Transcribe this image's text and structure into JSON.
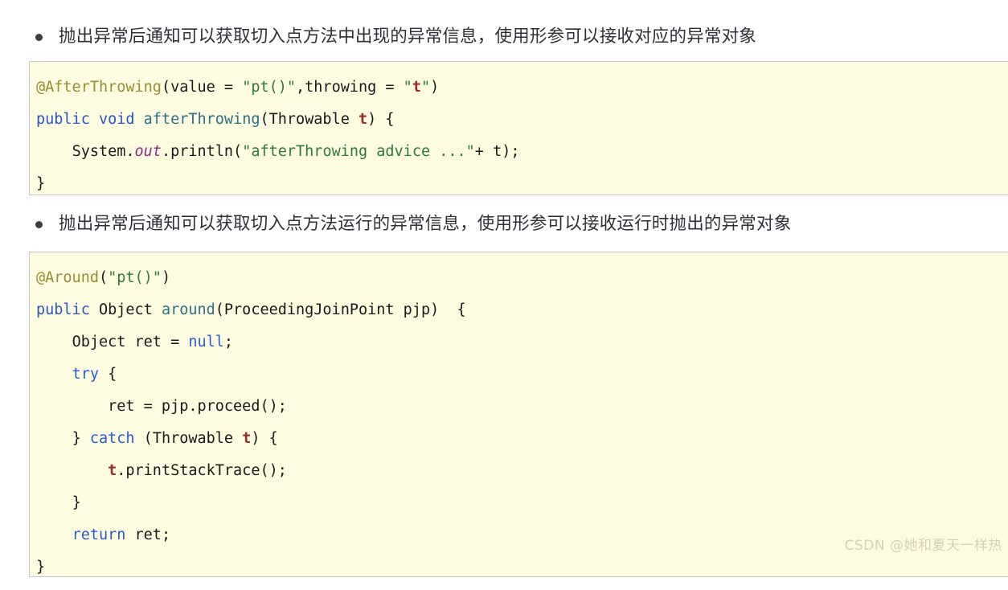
{
  "document": {
    "watermark": "CSDN @她和夏天一样热"
  },
  "sections": [
    {
      "bullet": "抛出异常后通知可以获取切入点方法中出现的异常信息，使用形参可以接收对应的异常对象",
      "code_lines": [
        "@AfterThrowing(value = \"pt()\",throwing = \"t\")",
        "public void afterThrowing(Throwable t) {",
        "    System.out.println(\"afterThrowing advice ...\"+ t);",
        "}"
      ]
    },
    {
      "bullet": "抛出异常后通知可以获取切入点方法运行的异常信息，使用形参可以接收运行时抛出的异常对象",
      "code_lines": [
        "@Around(\"pt()\")",
        "public Object around(ProceedingJoinPoint pjp)  {",
        "    Object ret = null;",
        "    try {",
        "        ret = pjp.proceed();",
        "    } catch (Throwable t) {",
        "        t.printStackTrace();",
        "    }",
        "    return ret;",
        "}"
      ]
    }
  ],
  "code_block_1": {
    "line_1": {
      "anno": "@AfterThrowing",
      "p1": "(value = ",
      "str1": "\"pt()\"",
      "p2": ",throwing = ",
      "q_open": "\"",
      "var": "t",
      "q_close": "\"",
      "p3": ")"
    },
    "line_2": {
      "kw_public": "public",
      "sp1": " ",
      "kw_void": "void",
      "sp2": " ",
      "meth": "afterThrowing",
      "p1": "(Throwable ",
      "var": "t",
      "p2": ") {"
    },
    "line_3": {
      "indent": "    ",
      "p1": "System.",
      "field": "out",
      "p2": ".println(",
      "str": "\"afterThrowing advice ...\"",
      "p3": "+ t);"
    },
    "line_4": {
      "p1": "}"
    }
  },
  "code_block_2": {
    "line_1": {
      "anno": "@Around",
      "p1": "(",
      "str": "\"pt()\"",
      "p2": ")"
    },
    "line_2": {
      "kw_public": "public",
      "sp1": " ",
      "type": "Object",
      "sp2": " ",
      "meth": "around",
      "p1": "(ProceedingJoinPoint pjp)  {"
    },
    "line_3": {
      "indent": "    ",
      "p1": "Object ret = ",
      "kw_null": "null",
      "p2": ";"
    },
    "line_4": {
      "indent": "    ",
      "kw_try": "try",
      "p1": " {"
    },
    "line_5": {
      "indent": "        ",
      "p1": "ret = pjp.proceed();"
    },
    "line_6": {
      "indent": "    ",
      "p1": "} ",
      "kw_catch": "catch",
      "p2": " (Throwable ",
      "var": "t",
      "p3": ") {"
    },
    "line_7": {
      "indent": "        ",
      "var": "t",
      "p1": ".printStackTrace();"
    },
    "line_8": {
      "indent": "    ",
      "p1": "}"
    },
    "line_9": {
      "indent": "    ",
      "kw_return": "return",
      "p1": " ret;"
    },
    "line_10": {
      "p1": "}"
    }
  },
  "colors": {
    "code_background": "#fdfce1",
    "code_border": "#c7c7c7",
    "annotation": "#9b8b34",
    "keyword": "#2b56c6",
    "string": "#2d7a3e",
    "method": "#2a7387",
    "field_static": "#8a2f8a",
    "variable": "#9c2c2c",
    "text": "#2f2f37",
    "watermark": "#d6d2b4"
  }
}
